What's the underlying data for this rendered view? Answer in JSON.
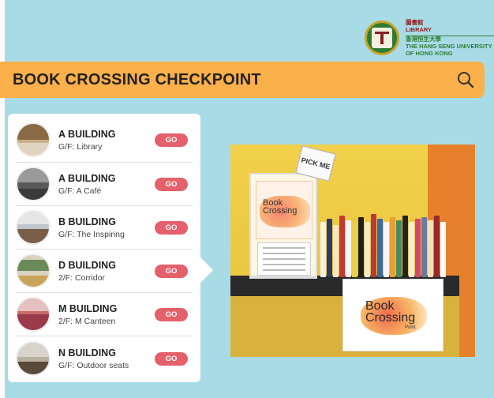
{
  "library": {
    "chinese_name": "圖書館",
    "english_name": "LIBRARY",
    "university_chinese": "香港恒生大學",
    "university_english_1": "THE HANG SENG UNIVERSITY",
    "university_english_2": "OF HONG KONG"
  },
  "header": {
    "title": "BOOK CROSSING CHECKPOINT"
  },
  "checkpoints": [
    {
      "building": "A BUILDING",
      "location": "G/F: Library",
      "action": "GO"
    },
    {
      "building": "A BUILDING",
      "location": "G/F: A Café",
      "action": "GO"
    },
    {
      "building": "B BUILDING",
      "location": "G/F: The Inspiring",
      "action": "GO"
    },
    {
      "building": "D BUILDING",
      "location": "2/F: Corridor",
      "action": "GO"
    },
    {
      "building": "M BUILDING",
      "location": "2/F: M Canteen",
      "action": "GO"
    },
    {
      "building": "N BUILDING",
      "location": "G/F: Outdoor seats",
      "action": "GO"
    }
  ],
  "photo": {
    "pickme_text": "PICK ME",
    "poster_text": "Book Crossing",
    "sign_text_1": "Book",
    "sign_text_2": "Crossing",
    "sign_sub": "Point"
  },
  "colors": {
    "background": "#a9dbe7",
    "title_bar": "#fbb04c",
    "go_button": "#e4606a"
  }
}
